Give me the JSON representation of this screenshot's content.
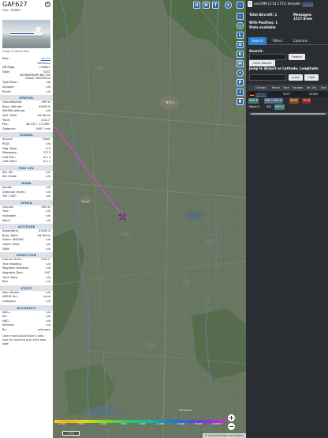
{
  "detail": {
    "callsign": "GAF627",
    "hex_line": "Hex.: 3F4627",
    "photo_credit": "Image © Marvin Bürk",
    "fields_top": [
      {
        "k": "Reg.:",
        "v": "14+02",
        "link": true
      },
      {
        "k": "",
        "v": "Germany"
      },
      {
        "k": "DB flags:",
        "v": "military"
      },
      {
        "k": "Type:",
        "v": "GLST"
      }
    ],
    "type_desc_1": "BOMBARDIER BD-700",
    "type_desc_2": "Global 5000/5500",
    "fields_type": [
      {
        "k": "Type Desc.:",
        "v": "L2J"
      },
      {
        "k": "Squawk:",
        "v": "n/a"
      },
      {
        "k": "Route:",
        "v": "n/a"
      }
    ],
    "sections": [
      {
        "title": "SPATIAL",
        "rows": [
          {
            "k": "Groundspeed:",
            "v": "499 kt"
          },
          {
            "k": "Baro. altitude:",
            "v": "41000 ft"
          },
          {
            "k": "WGS84 altitude:",
            "v": "n/a"
          },
          {
            "k": "Vert. Rate:",
            "v": "64 ft/min"
          },
          {
            "k": "Track:",
            "v": "134.1°"
          },
          {
            "k": "Pos.:",
            "v": "48.131°, 17.065°"
          },
          {
            "k": "Distance:",
            "v": "548.7 nmi"
          }
        ]
      },
      {
        "title": "SIGNAL",
        "rows": [
          {
            "k": "Source:",
            "v": "Other"
          },
          {
            "k": "RSSI:",
            "v": "n/a"
          },
          {
            "k": "Msg. Rate:",
            "v": "0.0"
          },
          {
            "k": "Messages:",
            "v": "1775"
          },
          {
            "k": "Last Pos.:",
            "v": "6.1 s"
          },
          {
            "k": "Last Seen:",
            "v": "6.1 s"
          }
        ]
      },
      {
        "title": "FMS SEL",
        "rows": [
          {
            "k": "Sel. Alt.:",
            "v": "n/a"
          },
          {
            "k": "Sel. Head.:",
            "v": "n/a"
          }
        ]
      },
      {
        "title": "WIND",
        "rows": [
          {
            "k": "Speed:",
            "v": "n/a"
          },
          {
            "k": "Direction (from):",
            "v": "n/a"
          },
          {
            "k": "TAT / OAT:",
            "v": "n/a"
          }
        ]
      },
      {
        "title": "SPEED",
        "rows": [
          {
            "k": "Ground:",
            "v": "499 kt"
          },
          {
            "k": "True:",
            "v": "n/a"
          },
          {
            "k": "Indicated:",
            "v": "n/a"
          },
          {
            "k": "Mach:",
            "v": "n/a"
          }
        ]
      },
      {
        "title": "ALTITUDE",
        "rows": [
          {
            "k": "Barometric:",
            "v": "41000 ft"
          },
          {
            "k": "Baro. Rate:",
            "v": "64 ft/min"
          },
          {
            "k": "Geom. WGS84:",
            "v": "n/a"
          },
          {
            "k": "Geom. Rate:",
            "v": "n/a"
          },
          {
            "k": "QNH:",
            "v": "n/a"
          }
        ]
      },
      {
        "title": "DIRECTION",
        "rows": [
          {
            "k": "Ground Track:",
            "v": "134.1°"
          },
          {
            "k": "True Heading:",
            "v": "n/a"
          },
          {
            "k": "Magnetic Heading:",
            "v": "n/a"
          },
          {
            "k": "Magnetic Decl.:",
            "v": "5.8°"
          },
          {
            "k": "Track Rate:",
            "v": "n/a"
          },
          {
            "k": "Roll:",
            "v": "n/a"
          }
        ]
      },
      {
        "title": "STUFF",
        "rows": [
          {
            "k": "Nav. Modes:",
            "v": "n/a"
          },
          {
            "k": "ADS-B Ver.:",
            "v": "none"
          },
          {
            "k": "Category:",
            "v": "n/a"
          }
        ]
      },
      {
        "title": "ACCURACY",
        "rows": [
          {
            "k": "NACₚ:",
            "v": "n/a"
          },
          {
            "k": "SIL:",
            "v": "n/a"
          },
          {
            "k": "NACᵥ:",
            "v": "n/a"
          },
          {
            "k": "NICbaro:",
            "v": "n/a"
          },
          {
            "k": "Rc:",
            "v": "unknown"
          }
        ]
      }
    ],
    "footer_note": "Learn more about Mode S data type by hovering over each data label"
  },
  "map": {
    "top_buttons": [
      "U",
      "H",
      "T"
    ],
    "side_buttons": [
      "L",
      "O",
      "K",
      "M",
      "P",
      "I",
      "R"
    ],
    "place_labels": [
      "Nitra",
      "Sereď",
      "Komárno"
    ],
    "altitude_scale": [
      "<1 000",
      "2 000",
      "4 000",
      "6 000",
      "8 000",
      "10 000",
      "20 000",
      "30 000",
      "40 000 ft"
    ],
    "scale_text": "2 km",
    "zoom_in": "+",
    "zoom_out": "−",
    "attribution": "© OpenStreetMap contributors."
  },
  "sidebar": {
    "version_text": "ver1098 (3.14.1751) decoder:",
    "version_link": "readsb",
    "stats": {
      "total_aircraft": "Total Aircraft: 1",
      "with_position": "With Position: 1",
      "stats_available": "Stats available",
      "messages_label": "Messages:",
      "messages_value": "1517.8/sec"
    },
    "tabs": [
      "Search",
      "Filters",
      "Columns"
    ],
    "search_label": "Search:",
    "search_button": "Search",
    "clear_search": "Clear Search",
    "jump_label": "Jump to Airport or Latitude, Longitude:",
    "jump_button": "Jump",
    "clear_button": "Clear",
    "table": {
      "columns": [
        "Callsign",
        "Route",
        "Type",
        "Squawk",
        "Alt. (ft)",
        "Spd"
      ],
      "rows": [
        {
          "callsign": "GAF627",
          "route": "",
          "type": "GLST",
          "squawk": "",
          "alt": "41000",
          "spd": ""
        }
      ]
    },
    "source_legend": [
      {
        "label": "ADS-B",
        "color": "#3c7a6b"
      },
      {
        "label": "UAT / ADS-R",
        "color": "#4d6c8a"
      },
      {
        "label": "MLAT",
        "color": "#8a4d24"
      },
      {
        "label": "TIS-B",
        "color": "#8b2a2a"
      },
      {
        "label": "Mode-S",
        "color": ""
      },
      {
        "label": "AIS",
        "color": ""
      },
      {
        "label": "ADS-C",
        "color": "#3c7a6b"
      }
    ]
  },
  "colors": {
    "accent": "#2f7fd6",
    "map_button": "#2b67a8",
    "track_line": "#e141d9",
    "aircraft": "#b32cc7"
  }
}
